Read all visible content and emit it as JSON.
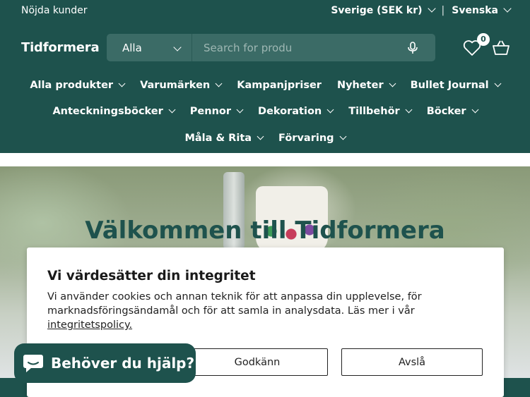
{
  "topbar": {
    "left_text": "Nöjda kunder",
    "region_label": "Sverige (SEK kr)",
    "separator": "|",
    "language_label": "Svenska"
  },
  "logo": "Tidformera",
  "search": {
    "category": "Alla",
    "placeholder": "Search for produ"
  },
  "cart": {
    "count": "0"
  },
  "nav": {
    "row1": [
      "Alla produkter",
      "Varumärken",
      "Kampanjpriser",
      "Nyheter",
      "Bullet Journal"
    ],
    "row1_has_dropdown": [
      true,
      true,
      false,
      true,
      true
    ],
    "row2": [
      "Anteckningsböcker",
      "Pennor",
      "Dekoration",
      "Tillbehör",
      "Böcker"
    ],
    "row3": [
      "Måla & Rita",
      "Förvaring"
    ]
  },
  "hero": {
    "title": "Välkommen till Tidformera"
  },
  "cookie": {
    "title": "Vi värdesätter din integritet",
    "text": "Vi använder cookies och annan teknik för att anpassa din upplevelse, för marknadsföringsändamål och för att samla in analysdata. Läs mer i vår",
    "link": "integritetspolicy.",
    "accept_label": "Godkänn",
    "decline_label": "Avslå"
  },
  "chat": {
    "label": "Behöver du hjälp?"
  },
  "colors": {
    "brand": "#1e524d",
    "search_bg": "#3b6b66"
  }
}
